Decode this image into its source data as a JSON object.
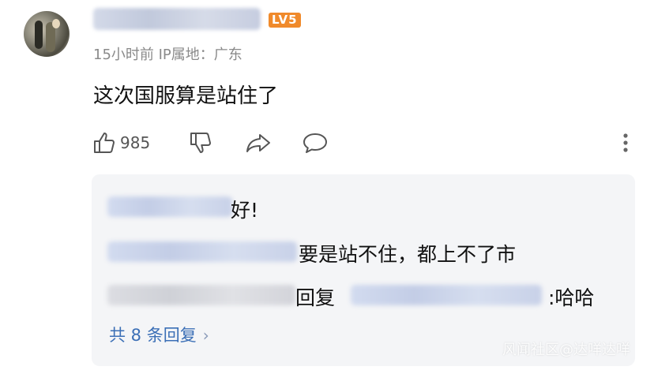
{
  "comment": {
    "level_badge": "LV5",
    "meta": "15小时前 IP属地：广东",
    "content": "这次国服算是站住了",
    "like_count": "985",
    "icons": [
      "thumbs-up-icon",
      "thumbs-down-icon",
      "share-icon",
      "comment-icon",
      "more-icon"
    ]
  },
  "replies": {
    "items": [
      {
        "text": "好!"
      },
      {
        "text": "要是站不住，都上不了市"
      },
      {
        "prefix": "回复",
        "suffix": ":哈哈"
      }
    ],
    "more_label": "共 8 条回复",
    "more_chevron": "›"
  },
  "watermark": "风闻社区@达咩达咩"
}
